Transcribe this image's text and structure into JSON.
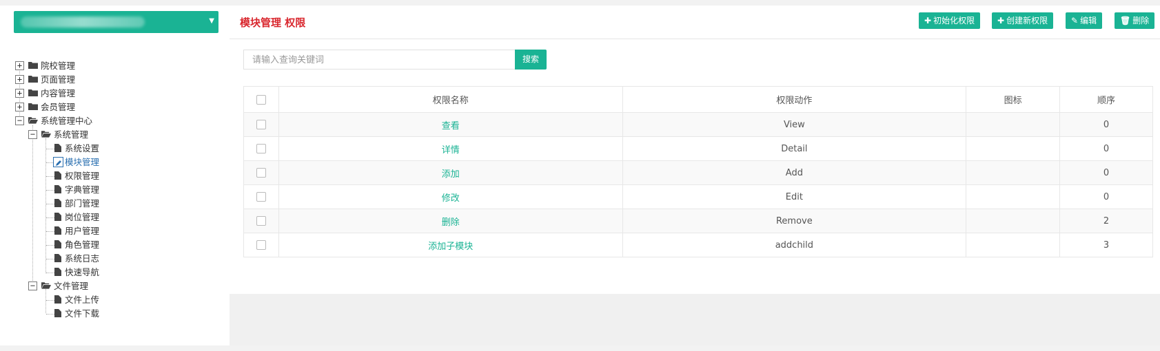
{
  "org_select": {
    "value": ""
  },
  "tree": {
    "roots": [
      {
        "label": "院校管理",
        "expanded": false
      },
      {
        "label": "页面管理",
        "expanded": false
      },
      {
        "label": "内容管理",
        "expanded": false
      },
      {
        "label": "会员管理",
        "expanded": false
      },
      {
        "label": "系统管理中心",
        "expanded": true,
        "children": [
          {
            "label": "系统管理",
            "expanded": true,
            "children": [
              "系统设置",
              "模块管理",
              "权限管理",
              "字典管理",
              "部门管理",
              "岗位管理",
              "用户管理",
              "角色管理",
              "系统日志",
              "快速导航"
            ]
          },
          {
            "label": "文件管理",
            "expanded": true,
            "children": [
              "文件上传",
              "文件下载"
            ]
          }
        ]
      }
    ],
    "selected": "模块管理"
  },
  "header": {
    "title": "模块管理 权限",
    "buttons": [
      {
        "label": "初始化权限",
        "icon": "plus-icon"
      },
      {
        "label": "创建新权限",
        "icon": "plus-icon"
      },
      {
        "label": "编辑",
        "icon": "pencil-icon"
      },
      {
        "label": "删除",
        "icon": "trash-icon"
      }
    ]
  },
  "search": {
    "placeholder": "请输入查询关键词",
    "value": "",
    "button_label": "搜索"
  },
  "table": {
    "columns": [
      "权限名称",
      "权限动作",
      "图标",
      "顺序"
    ],
    "rows": [
      {
        "name": "查看",
        "action": "View",
        "icon": "",
        "order": "0"
      },
      {
        "name": "详情",
        "action": "Detail",
        "icon": "",
        "order": "0"
      },
      {
        "name": "添加",
        "action": "Add",
        "icon": "",
        "order": "0"
      },
      {
        "name": "修改",
        "action": "Edit",
        "icon": "",
        "order": "0"
      },
      {
        "name": "删除",
        "action": "Remove",
        "icon": "",
        "order": "2"
      },
      {
        "name": "添加子模块",
        "action": "addchild",
        "icon": "",
        "order": "3"
      }
    ]
  },
  "colors": {
    "accent": "#1ab394",
    "title_red": "#d9272e",
    "selected_blue": "#2a6fb0"
  }
}
